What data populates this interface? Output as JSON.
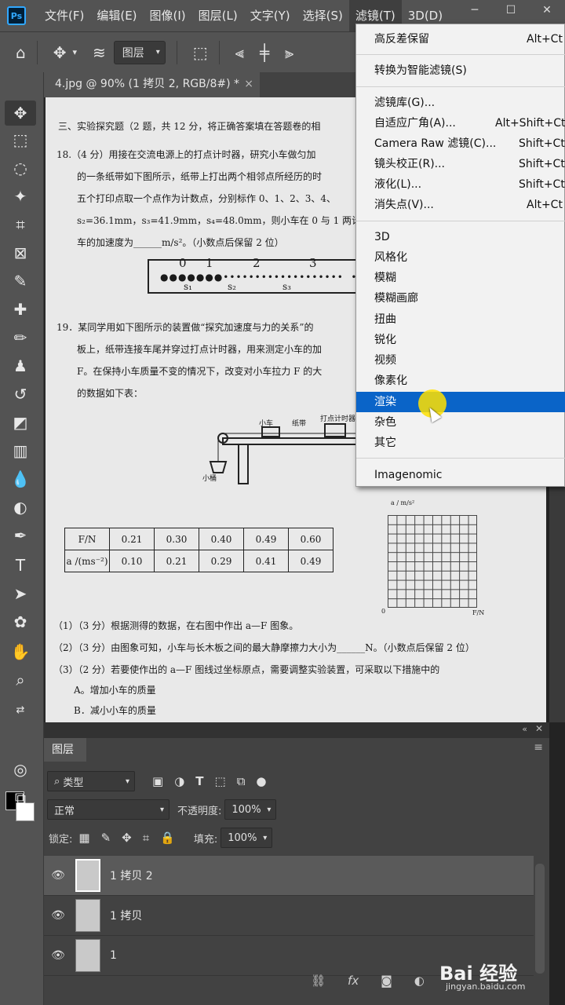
{
  "app": {
    "logo": "Ps"
  },
  "menubar": {
    "items": [
      "文件(F)",
      "编辑(E)",
      "图像(I)",
      "图层(L)",
      "文字(Y)",
      "选择(S)",
      "滤镜(T)",
      "3D(D)"
    ],
    "active": "滤镜(T)"
  },
  "window_controls": {
    "minimize": "─",
    "maximize": "☐",
    "close": "✕"
  },
  "options_bar": {
    "layer_select": "图层"
  },
  "document_tab": {
    "title": "4.jpg @ 90% (1 拷贝 2, RGB/8#) *",
    "close": "×"
  },
  "filter_menu": {
    "items": [
      {
        "label": "高反差保留",
        "shortcut": "Alt+Ct"
      },
      {
        "label": "转换为智能滤镜(S)",
        "shortcut": ""
      },
      {
        "label": "滤镜库(G)...",
        "shortcut": ""
      },
      {
        "label": "自适应广角(A)...",
        "shortcut": "Alt+Shift+Ct"
      },
      {
        "label": "Camera Raw 滤镜(C)...",
        "shortcut": "Shift+Ct"
      },
      {
        "label": "镜头校正(R)...",
        "shortcut": "Shift+Ct"
      },
      {
        "label": "液化(L)...",
        "shortcut": "Shift+Ct"
      },
      {
        "label": "消失点(V)...",
        "shortcut": "Alt+Ct"
      },
      {
        "label": "3D",
        "shortcut": ""
      },
      {
        "label": "风格化",
        "shortcut": ""
      },
      {
        "label": "模糊",
        "shortcut": ""
      },
      {
        "label": "模糊画廊",
        "shortcut": ""
      },
      {
        "label": "扭曲",
        "shortcut": ""
      },
      {
        "label": "锐化",
        "shortcut": ""
      },
      {
        "label": "视频",
        "shortcut": ""
      },
      {
        "label": "像素化",
        "shortcut": ""
      },
      {
        "label": "渲染",
        "shortcut": ""
      },
      {
        "label": "杂色",
        "shortcut": ""
      },
      {
        "label": "其它",
        "shortcut": ""
      },
      {
        "label": "Imagenomic",
        "shortcut": ""
      }
    ],
    "highlighted": "渲染"
  },
  "document": {
    "section": "三、实验探究题（2 题，共 12 分，将正确答案填在答题卷的相",
    "q18_l1": "18.（4 分）用接在交流电源上的打点计时器，研究小车做匀加",
    "q18_l2": "的一条纸带如下图所示，纸带上打出两个相邻点所经历的时",
    "q18_l3": "五个打印点取一个点作为计数点，分别标作 0、1、2、3、4、",
    "q18_l4": "s₂=36.1mm，s₃=41.9mm，s₄=48.0mm，则小车在 0 与 1 两计",
    "q18_l5": "车的加速度为______m/s²。（小数点后保留 2 位）",
    "tape_labels": [
      "0",
      "1",
      "2",
      "3"
    ],
    "tape_s": [
      "s₁",
      "s₂",
      "s₃"
    ],
    "q19_l1": "19．某同学用如下图所示的装置做“探究加速度与力的关系”的",
    "q19_l2": "板上，纸带连接车尾并穿过打点计时器，用来测定小车的加",
    "q19_l3": "F。在保持小车质量不变的情况下，改变对小车拉力 F 的大",
    "q19_l4": "的数据如下表：",
    "apparatus": {
      "cart": "小车",
      "tape": "纸带",
      "timer": "打点计时器",
      "bucket": "小桶"
    },
    "table": {
      "row1_head": "F/N",
      "row1": [
        "0.21",
        "0.30",
        "0.40",
        "0.49",
        "0.60"
      ],
      "row2_head": "a /(ms⁻²)",
      "row2": [
        "0.10",
        "0.21",
        "0.29",
        "0.41",
        "0.49"
      ]
    },
    "grid": {
      "ylabel": "a / m/s²",
      "xlabel": "F/N",
      "origin": "0"
    },
    "sub1": "（1）（3 分）根据测得的数据，在右图中作出 a—F 图象。",
    "sub2": "（2）（3 分）由图象可知，小车与长木板之间的最大静摩擦力大小为______N。（小数点后保留 2 位）",
    "sub3": "（3）（2 分）若要使作出的 a—F 图线过坐标原点，需要调整实验装置，可采取以下措施中的",
    "optA": "A。增加小车的质量",
    "optB": "B．减小小车的质量"
  },
  "layers_panel": {
    "tab": "图层",
    "filter_kind": "类型",
    "blend_mode": "正常",
    "opacity_label": "不透明度:",
    "opacity_value": "100%",
    "lock_label": "锁定:",
    "fill_label": "填充:",
    "fill_value": "100%",
    "layers": [
      {
        "name": "1 拷贝 2",
        "selected": true
      },
      {
        "name": "1 拷贝",
        "selected": false
      },
      {
        "name": "1",
        "selected": false
      }
    ]
  },
  "watermark": {
    "main": "Bai 经验",
    "sub": "jingyan.baidu.com"
  }
}
